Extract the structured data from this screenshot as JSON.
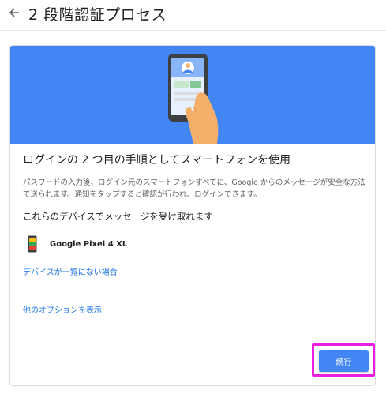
{
  "header": {
    "back_icon": "arrow-left-icon",
    "title": "2 段階認証プロセス"
  },
  "card": {
    "banner_illustration": "hand-holding-phone-illustration",
    "heading": "ログインの 2 つ目の手順としてスマートフォンを使用",
    "description": "パスワードの入力後、ログイン元のスマートフォンすべてに、Google からのメッセージが安全な方法で送られます。通知をタップすると確認が行われ、ログインできます。",
    "devices_heading": "これらのデバイスでメッセージを受け取れます",
    "devices": [
      {
        "icon": "smartphone-icon",
        "name": "Google Pixel 4 XL"
      }
    ],
    "link_device_missing": "デバイスが一覧にない場合",
    "link_other_options": "他のオプションを表示",
    "continue_label": "続行"
  },
  "colors": {
    "banner": "#4285f4",
    "link": "#1a73e8",
    "button": "#4285f4",
    "highlight": "#e91ee1"
  }
}
